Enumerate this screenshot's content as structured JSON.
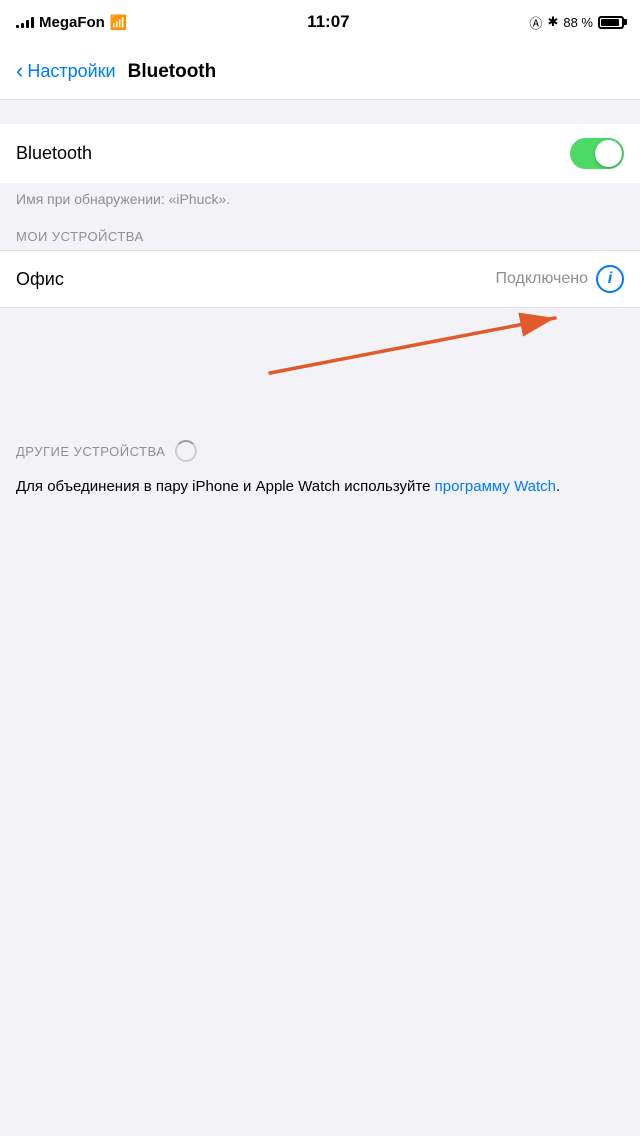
{
  "statusBar": {
    "carrier": "MegaFon",
    "time": "11:07",
    "batteryPercent": "88 %",
    "icons": {
      "location": "@",
      "bluetooth": "✱"
    }
  },
  "navBar": {
    "backLabel": "Настройки",
    "title": "Bluetooth"
  },
  "bluetoothSection": {
    "toggleLabel": "Bluetooth",
    "toggleOn": true,
    "discoveryNote": "Имя при обнаружении: «iPhuck»."
  },
  "myDevicesSection": {
    "header": "МОИ УСТРОЙСТВА",
    "devices": [
      {
        "name": "Офис",
        "status": "Подключено"
      }
    ]
  },
  "otherDevicesSection": {
    "header": "ДРУГИЕ УСТРОЙСТВА",
    "description": "Для объединения в пару iPhone и Apple Watch используйте ",
    "linkText": "программу Watch",
    "descriptionEnd": "."
  },
  "arrow": {
    "label": "annotation-arrow"
  }
}
